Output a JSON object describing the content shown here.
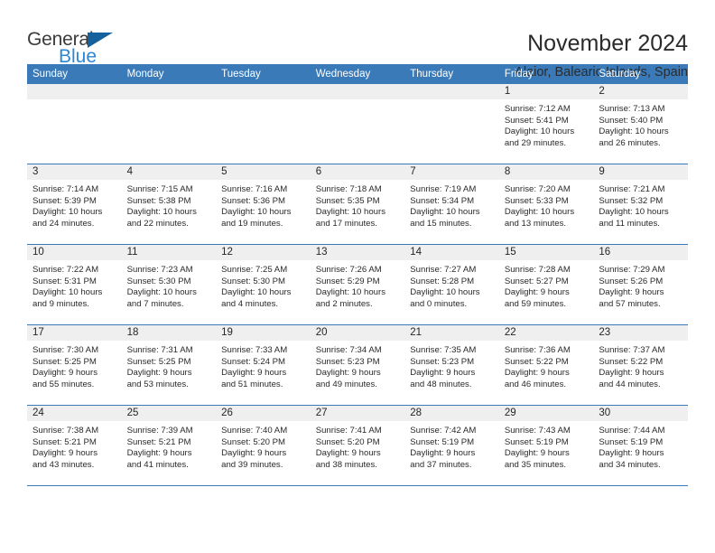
{
  "logo": {
    "word1": "General",
    "word2": "Blue",
    "triangle_color": "#15619e",
    "blue_color": "#2c87d4"
  },
  "header": {
    "title": "November 2024",
    "subtitle": "Alaior, Balearic Islands, Spain"
  },
  "theme": {
    "header_bg": "#3a7ab8",
    "daynum_band_bg": "#efefef",
    "grid_line": "#3a7ab8"
  },
  "weekday_headers": [
    "Sunday",
    "Monday",
    "Tuesday",
    "Wednesday",
    "Thursday",
    "Friday",
    "Saturday"
  ],
  "weeks": [
    [
      {
        "day": "",
        "empty": true
      },
      {
        "day": "",
        "empty": true
      },
      {
        "day": "",
        "empty": true
      },
      {
        "day": "",
        "empty": true
      },
      {
        "day": "",
        "empty": true
      },
      {
        "day": "1",
        "sunrise": "Sunrise: 7:12 AM",
        "sunset": "Sunset: 5:41 PM",
        "daylight1": "Daylight: 10 hours",
        "daylight2": "and 29 minutes."
      },
      {
        "day": "2",
        "sunrise": "Sunrise: 7:13 AM",
        "sunset": "Sunset: 5:40 PM",
        "daylight1": "Daylight: 10 hours",
        "daylight2": "and 26 minutes."
      }
    ],
    [
      {
        "day": "3",
        "sunrise": "Sunrise: 7:14 AM",
        "sunset": "Sunset: 5:39 PM",
        "daylight1": "Daylight: 10 hours",
        "daylight2": "and 24 minutes."
      },
      {
        "day": "4",
        "sunrise": "Sunrise: 7:15 AM",
        "sunset": "Sunset: 5:38 PM",
        "daylight1": "Daylight: 10 hours",
        "daylight2": "and 22 minutes."
      },
      {
        "day": "5",
        "sunrise": "Sunrise: 7:16 AM",
        "sunset": "Sunset: 5:36 PM",
        "daylight1": "Daylight: 10 hours",
        "daylight2": "and 19 minutes."
      },
      {
        "day": "6",
        "sunrise": "Sunrise: 7:18 AM",
        "sunset": "Sunset: 5:35 PM",
        "daylight1": "Daylight: 10 hours",
        "daylight2": "and 17 minutes."
      },
      {
        "day": "7",
        "sunrise": "Sunrise: 7:19 AM",
        "sunset": "Sunset: 5:34 PM",
        "daylight1": "Daylight: 10 hours",
        "daylight2": "and 15 minutes."
      },
      {
        "day": "8",
        "sunrise": "Sunrise: 7:20 AM",
        "sunset": "Sunset: 5:33 PM",
        "daylight1": "Daylight: 10 hours",
        "daylight2": "and 13 minutes."
      },
      {
        "day": "9",
        "sunrise": "Sunrise: 7:21 AM",
        "sunset": "Sunset: 5:32 PM",
        "daylight1": "Daylight: 10 hours",
        "daylight2": "and 11 minutes."
      }
    ],
    [
      {
        "day": "10",
        "sunrise": "Sunrise: 7:22 AM",
        "sunset": "Sunset: 5:31 PM",
        "daylight1": "Daylight: 10 hours",
        "daylight2": "and 9 minutes."
      },
      {
        "day": "11",
        "sunrise": "Sunrise: 7:23 AM",
        "sunset": "Sunset: 5:30 PM",
        "daylight1": "Daylight: 10 hours",
        "daylight2": "and 7 minutes."
      },
      {
        "day": "12",
        "sunrise": "Sunrise: 7:25 AM",
        "sunset": "Sunset: 5:30 PM",
        "daylight1": "Daylight: 10 hours",
        "daylight2": "and 4 minutes."
      },
      {
        "day": "13",
        "sunrise": "Sunrise: 7:26 AM",
        "sunset": "Sunset: 5:29 PM",
        "daylight1": "Daylight: 10 hours",
        "daylight2": "and 2 minutes."
      },
      {
        "day": "14",
        "sunrise": "Sunrise: 7:27 AM",
        "sunset": "Sunset: 5:28 PM",
        "daylight1": "Daylight: 10 hours",
        "daylight2": "and 0 minutes."
      },
      {
        "day": "15",
        "sunrise": "Sunrise: 7:28 AM",
        "sunset": "Sunset: 5:27 PM",
        "daylight1": "Daylight: 9 hours",
        "daylight2": "and 59 minutes."
      },
      {
        "day": "16",
        "sunrise": "Sunrise: 7:29 AM",
        "sunset": "Sunset: 5:26 PM",
        "daylight1": "Daylight: 9 hours",
        "daylight2": "and 57 minutes."
      }
    ],
    [
      {
        "day": "17",
        "sunrise": "Sunrise: 7:30 AM",
        "sunset": "Sunset: 5:25 PM",
        "daylight1": "Daylight: 9 hours",
        "daylight2": "and 55 minutes."
      },
      {
        "day": "18",
        "sunrise": "Sunrise: 7:31 AM",
        "sunset": "Sunset: 5:25 PM",
        "daylight1": "Daylight: 9 hours",
        "daylight2": "and 53 minutes."
      },
      {
        "day": "19",
        "sunrise": "Sunrise: 7:33 AM",
        "sunset": "Sunset: 5:24 PM",
        "daylight1": "Daylight: 9 hours",
        "daylight2": "and 51 minutes."
      },
      {
        "day": "20",
        "sunrise": "Sunrise: 7:34 AM",
        "sunset": "Sunset: 5:23 PM",
        "daylight1": "Daylight: 9 hours",
        "daylight2": "and 49 minutes."
      },
      {
        "day": "21",
        "sunrise": "Sunrise: 7:35 AM",
        "sunset": "Sunset: 5:23 PM",
        "daylight1": "Daylight: 9 hours",
        "daylight2": "and 48 minutes."
      },
      {
        "day": "22",
        "sunrise": "Sunrise: 7:36 AM",
        "sunset": "Sunset: 5:22 PM",
        "daylight1": "Daylight: 9 hours",
        "daylight2": "and 46 minutes."
      },
      {
        "day": "23",
        "sunrise": "Sunrise: 7:37 AM",
        "sunset": "Sunset: 5:22 PM",
        "daylight1": "Daylight: 9 hours",
        "daylight2": "and 44 minutes."
      }
    ],
    [
      {
        "day": "24",
        "sunrise": "Sunrise: 7:38 AM",
        "sunset": "Sunset: 5:21 PM",
        "daylight1": "Daylight: 9 hours",
        "daylight2": "and 43 minutes."
      },
      {
        "day": "25",
        "sunrise": "Sunrise: 7:39 AM",
        "sunset": "Sunset: 5:21 PM",
        "daylight1": "Daylight: 9 hours",
        "daylight2": "and 41 minutes."
      },
      {
        "day": "26",
        "sunrise": "Sunrise: 7:40 AM",
        "sunset": "Sunset: 5:20 PM",
        "daylight1": "Daylight: 9 hours",
        "daylight2": "and 39 minutes."
      },
      {
        "day": "27",
        "sunrise": "Sunrise: 7:41 AM",
        "sunset": "Sunset: 5:20 PM",
        "daylight1": "Daylight: 9 hours",
        "daylight2": "and 38 minutes."
      },
      {
        "day": "28",
        "sunrise": "Sunrise: 7:42 AM",
        "sunset": "Sunset: 5:19 PM",
        "daylight1": "Daylight: 9 hours",
        "daylight2": "and 37 minutes."
      },
      {
        "day": "29",
        "sunrise": "Sunrise: 7:43 AM",
        "sunset": "Sunset: 5:19 PM",
        "daylight1": "Daylight: 9 hours",
        "daylight2": "and 35 minutes."
      },
      {
        "day": "30",
        "sunrise": "Sunrise: 7:44 AM",
        "sunset": "Sunset: 5:19 PM",
        "daylight1": "Daylight: 9 hours",
        "daylight2": "and 34 minutes."
      }
    ]
  ]
}
